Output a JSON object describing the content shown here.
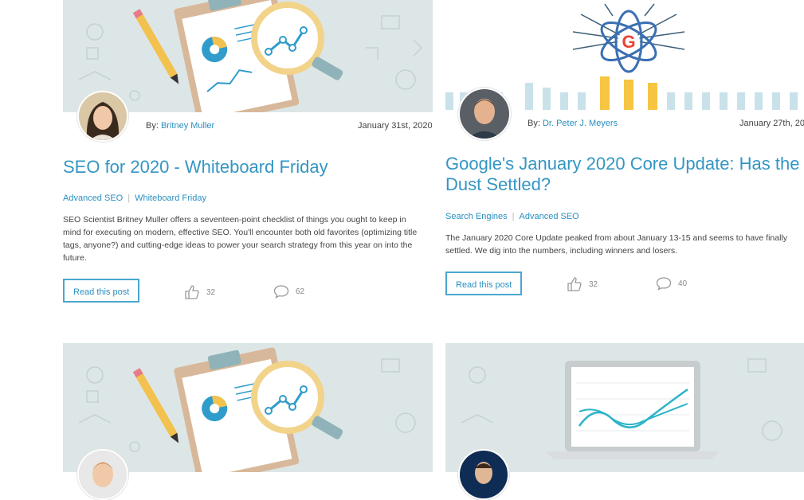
{
  "posts": [
    {
      "author_prefix": "By: ",
      "author": "Britney Muller",
      "date": "January 31st, 2020",
      "title": "SEO for 2020 - Whiteboard Friday",
      "tags": [
        "Advanced SEO",
        "Whiteboard Friday"
      ],
      "summary": "SEO Scientist Britney Muller offers a seventeen-point checklist of things you ought to keep in mind for executing on modern, effective SEO. You'll encounter both old favorites (optimizing title tags, anyone?) and cutting-edge ideas to power your search strategy from this year on into the future.",
      "read_label": "Read this post",
      "likes": "32",
      "comments": "62"
    },
    {
      "author_prefix": "By: ",
      "author": "Dr. Peter J. Meyers",
      "date": "January 27th, 20",
      "title": "Google's January 2020 Core Update: Has the Dust Settled?",
      "tags": [
        "Search Engines",
        "Advanced SEO"
      ],
      "summary": "The January 2020 Core Update peaked from about January 13-15 and seems to have finally settled. We dig into the numbers, including winners and losers.",
      "read_label": "Read this post",
      "likes": "32",
      "comments": "40"
    }
  ],
  "colors": {
    "link": "#2a8fbf",
    "title": "#3496c3",
    "banner_bg": "#dde6e6",
    "button_border": "#4aa7cf"
  }
}
